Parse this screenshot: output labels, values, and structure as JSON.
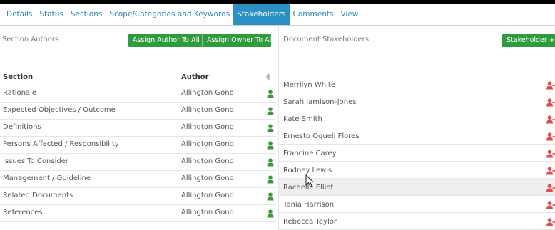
{
  "tabs": [
    {
      "label": "Details"
    },
    {
      "label": "Status"
    },
    {
      "label": "Sections"
    },
    {
      "label": "Scope/Categories and Keywords"
    },
    {
      "label": "Stakeholders",
      "active": true
    },
    {
      "label": "Comments"
    },
    {
      "label": "View"
    }
  ],
  "left_panel": {
    "title": "Section Authors",
    "assign_author_label": "Assign Author To All",
    "assign_owner_label": "Assign Owner To All",
    "columns": {
      "section": "Section",
      "author": "Author"
    },
    "rows": [
      {
        "section": "Rationale",
        "author": "Allington Gono"
      },
      {
        "section": "Expected Objectives / Outcome",
        "author": "Allington Gono"
      },
      {
        "section": "Definitions",
        "author": "Allington Gono"
      },
      {
        "section": "Persons Affected / Responsibility",
        "author": "Allington Gono"
      },
      {
        "section": "Issues To Consider",
        "author": "Allington Gono"
      },
      {
        "section": "Management / Guideline",
        "author": "Allington Gono"
      },
      {
        "section": "Related Documents",
        "author": "Allington Gono"
      },
      {
        "section": "References",
        "author": "Allington Gono"
      }
    ]
  },
  "right_panel": {
    "title": "Document Stakeholders",
    "stakeholder_button_label": "Stakeholder +",
    "stakeholders": [
      {
        "name": "Merrilyn White"
      },
      {
        "name": "Sarah Jamison-Jones"
      },
      {
        "name": "Kate Smith"
      },
      {
        "name": "Ernesto Oqueli Flores"
      },
      {
        "name": "Francine Carey"
      },
      {
        "name": "Rodney Lewis"
      },
      {
        "name": "Rachelle Elliot",
        "highlighted": true
      },
      {
        "name": "Tania Harrison"
      },
      {
        "name": "Rebecca Taylor"
      }
    ]
  },
  "colors": {
    "tab_active": "#2c90c2",
    "tab_link": "#2b86b8",
    "button_green": "#2e9c3d",
    "author_icon_green": "#3a9a3a",
    "remove_icon_red": "#e04b4b"
  },
  "icons": {
    "author_icon": "user-icon",
    "remove_icon": "user-remove-icon",
    "sort_icon": "sort-icon"
  }
}
